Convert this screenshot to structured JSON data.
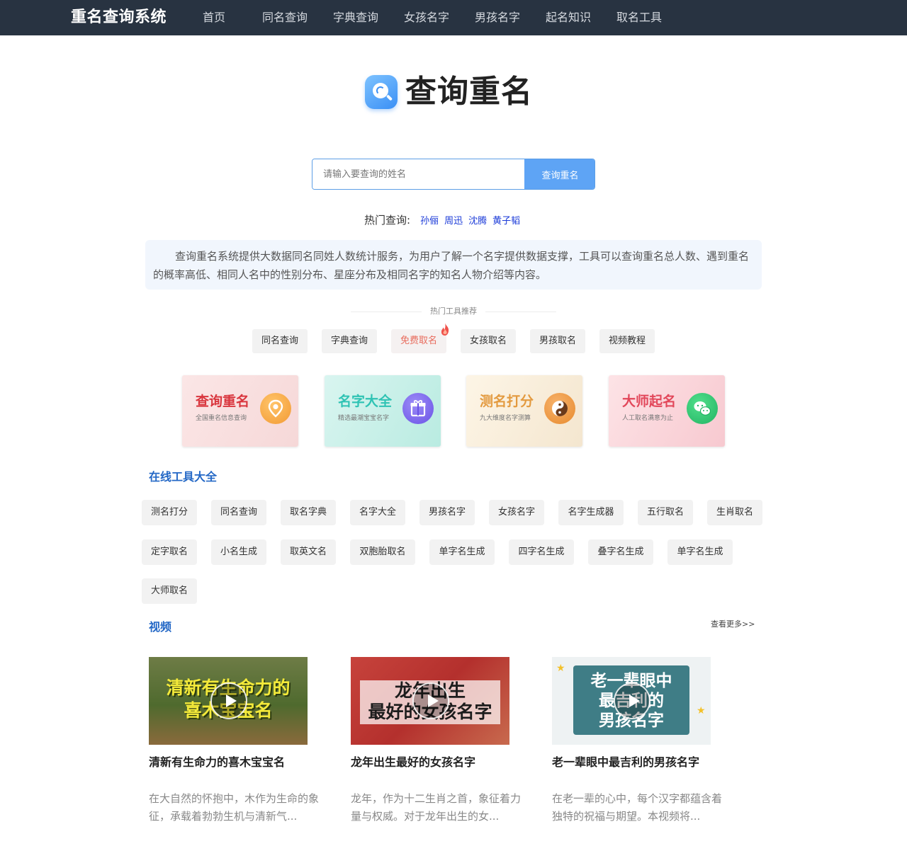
{
  "header": {
    "brand": "重名查询系统",
    "nav": [
      "首页",
      "同名查询",
      "字典查询",
      "女孩名字",
      "男孩名字",
      "起名知识",
      "取名工具"
    ]
  },
  "logo": {
    "text": "查询重名",
    "icon": "search-icon"
  },
  "search": {
    "placeholder": "请输入要查询的姓名",
    "value": "",
    "button": "查询重名"
  },
  "hot_search": {
    "label": "热门查询:",
    "names": [
      "孙俪",
      "周迅",
      "沈腾",
      "黄子韬"
    ]
  },
  "intro": "查询重名系统提供大数据同名同姓人数统计服务，为用户了解一个名字提供数据支撑，工具可以查询重名总人数、遇到重名的概率高低、相同人名中的性别分布、星座分布及相同名字的知名人物介绍等内容。",
  "hot_tools": {
    "title": "热门工具推荐",
    "items": [
      "同名查询",
      "字典查询",
      "免费取名",
      "女孩取名",
      "男孩取名",
      "视频教程"
    ],
    "hot_index": 2,
    "hot_color": "#e86b5c"
  },
  "cards": [
    {
      "title": "查询重名",
      "sub": "全国重名信息查询",
      "icon": "location-pin-icon",
      "title_color": "#d9363e"
    },
    {
      "title": "名字大全",
      "sub": "精选最潮宝宝名字",
      "icon": "gift-icon",
      "title_color": "#2fc3b4"
    },
    {
      "title": "测名打分",
      "sub": "九大维度名字测算",
      "icon": "yin-yang-icon",
      "title_color": "#e39a3f"
    },
    {
      "title": "大师起名",
      "sub": "人工取名满意为止",
      "icon": "wechat-icon",
      "title_color": "#e2475a"
    }
  ],
  "online_tools": {
    "title": "在线工具大全",
    "items": [
      "测名打分",
      "同名查询",
      "取名字典",
      "名字大全",
      "男孩名字",
      "女孩名字",
      "名字生成器",
      "五行取名",
      "生肖取名",
      "定字取名",
      "小名生成",
      "取英文名",
      "双胞胎取名",
      "单字名生成",
      "四字名生成",
      "叠字名生成",
      "单字名生成",
      "大师取名"
    ]
  },
  "videos": {
    "title": "视频",
    "more": "查看更多>>",
    "items": [
      {
        "thumb_text": "清新有生命力的\n喜木宝宝名",
        "title": "清新有生命力的喜木宝宝名",
        "desc": "在大自然的怀抱中，木作为生命的象征，承载着勃勃生机与清新气..."
      },
      {
        "thumb_text": "龙年出生\n最好的女孩名字",
        "title": "龙年出生最好的女孩名字",
        "desc": "龙年，作为十二生肖之首，象征着力量与权威。对于龙年出生的女..."
      },
      {
        "thumb_text": "老一辈眼中\n最吉利的\n男孩名字",
        "title": "老一辈眼中最吉利的男孩名字",
        "desc": "在老一辈的心中，每个汉字都蕴含着独特的祝福与期望。本视频将..."
      }
    ]
  }
}
